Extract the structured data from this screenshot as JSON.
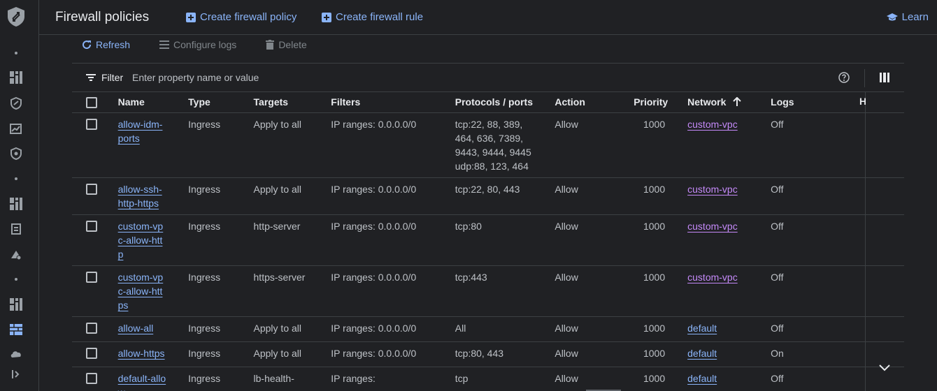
{
  "header": {
    "title": "Firewall policies",
    "create_policy": "Create firewall policy",
    "create_rule": "Create firewall rule",
    "learn": "Learn"
  },
  "toolbar": {
    "refresh": "Refresh",
    "configure_logs": "Configure logs",
    "delete": "Delete"
  },
  "filter": {
    "label": "Filter",
    "placeholder": "Enter property name or value"
  },
  "columns": {
    "name": "Name",
    "type": "Type",
    "targets": "Targets",
    "filters": "Filters",
    "protocols": "Protocols / ports",
    "action": "Action",
    "priority": "Priority",
    "network": "Network",
    "logs": "Logs",
    "hidden": "H"
  },
  "rows": [
    {
      "name": "allow-idm-ports",
      "type": "Ingress",
      "targets": "Apply to all",
      "filters": "IP ranges: 0.0.0.0/0",
      "protocols": [
        "tcp:22, 88, 389,",
        "464, 636, 7389,",
        "9443, 9444, 9445",
        "udp:88, 123, 464"
      ],
      "action": "Allow",
      "priority": "1000",
      "network": "custom-vpc",
      "logs": "Off"
    },
    {
      "name": "allow-ssh-http-https",
      "type": "Ingress",
      "targets": "Apply to all",
      "filters": "IP ranges: 0.0.0.0/0",
      "protocols": [
        "tcp:22, 80, 443"
      ],
      "action": "Allow",
      "priority": "1000",
      "network": "custom-vpc",
      "logs": "Off"
    },
    {
      "name": "custom-vpc-allow-http",
      "type": "Ingress",
      "targets": "http-server",
      "filters": "IP ranges: 0.0.0.0/0",
      "protocols": [
        "tcp:80"
      ],
      "action": "Allow",
      "priority": "1000",
      "network": "custom-vpc",
      "logs": "Off"
    },
    {
      "name": "custom-vpc-allow-https",
      "type": "Ingress",
      "targets": "https-server",
      "filters": "IP ranges: 0.0.0.0/0",
      "protocols": [
        "tcp:443"
      ],
      "action": "Allow",
      "priority": "1000",
      "network": "custom-vpc",
      "logs": "Off"
    },
    {
      "name": "allow-all",
      "type": "Ingress",
      "targets": "Apply to all",
      "filters": "IP ranges: 0.0.0.0/0",
      "protocols": [
        "All"
      ],
      "action": "Allow",
      "priority": "1000",
      "network": "default",
      "logs": "Off"
    },
    {
      "name": "allow-https",
      "type": "Ingress",
      "targets": "Apply to all",
      "filters": "IP ranges: 0.0.0.0/0",
      "protocols": [
        "tcp:80, 443"
      ],
      "action": "Allow",
      "priority": "1000",
      "network": "default",
      "logs": "On"
    },
    {
      "name": "default-allow-",
      "type": "Ingress",
      "targets": "lb-health-",
      "filters": "IP ranges:",
      "protocols": [
        "tcp"
      ],
      "action": "Allow",
      "priority": "1000",
      "network": "default",
      "logs": "Off"
    }
  ],
  "colors": {
    "accent": "#8ab4f8",
    "visited_link": "#c58af9",
    "background": "#202124",
    "divider": "#3c4043"
  }
}
